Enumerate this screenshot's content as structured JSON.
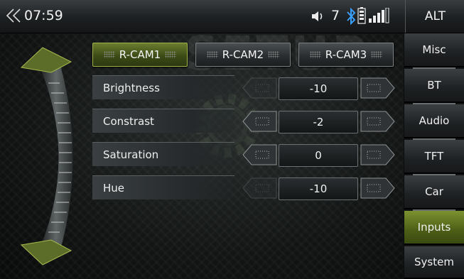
{
  "status": {
    "time": "07:59",
    "volume": "7",
    "alt_label": "ALT"
  },
  "background_text": "SETUP",
  "cameras": [
    {
      "label": "R-CAM1",
      "active": true
    },
    {
      "label": "R-CAM2",
      "active": false
    },
    {
      "label": "R-CAM3",
      "active": false
    }
  ],
  "settings": [
    {
      "label": "Brightness",
      "value": "-10"
    },
    {
      "label": "Constrast",
      "value": "-2"
    },
    {
      "label": "Saturation",
      "value": "0"
    },
    {
      "label": "Hue",
      "value": "-10"
    }
  ],
  "menu": [
    {
      "label": "Misc",
      "active": false
    },
    {
      "label": "BT",
      "active": false
    },
    {
      "label": "Audio",
      "active": false
    },
    {
      "label": "TFT",
      "active": false
    },
    {
      "label": "Car",
      "active": false
    },
    {
      "label": "Inputs",
      "active": true
    },
    {
      "label": "System",
      "active": false
    }
  ],
  "colors": {
    "accent_active": "#6b7d2f",
    "bluetooth": "#3aa0ff"
  },
  "icons": [
    "back-icon",
    "volume-icon",
    "bluetooth-icon",
    "battery-icon",
    "signal-icon",
    "gear-icon",
    "scroll-dial"
  ]
}
